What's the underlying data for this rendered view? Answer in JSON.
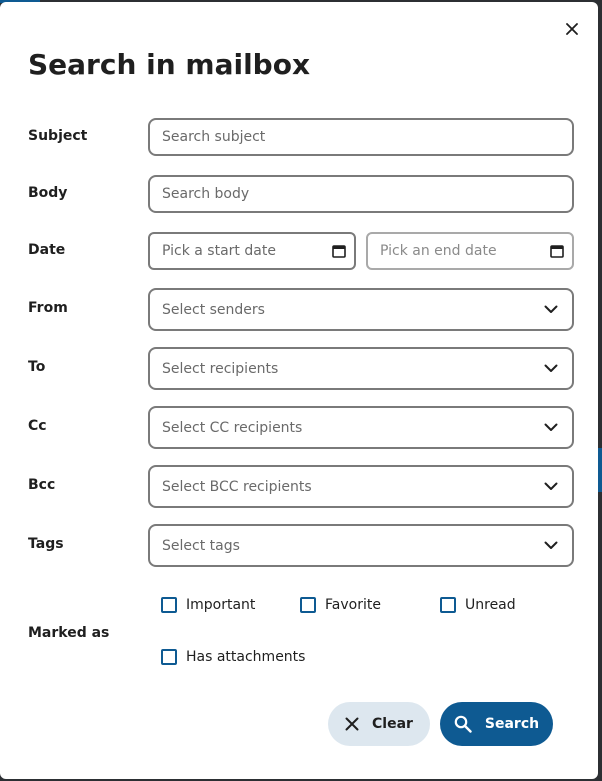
{
  "dialog": {
    "title": "Search in mailbox",
    "close_icon": "close-icon"
  },
  "fields": {
    "subject": {
      "label": "Subject",
      "placeholder": "Search subject"
    },
    "body": {
      "label": "Body",
      "placeholder": "Search body"
    },
    "date": {
      "label": "Date",
      "start_placeholder": "Pick a start date",
      "end_placeholder": "Pick an end date"
    },
    "from": {
      "label": "From",
      "placeholder": "Select senders"
    },
    "to": {
      "label": "To",
      "placeholder": "Select recipients"
    },
    "cc": {
      "label": "Cc",
      "placeholder": "Select CC recipients"
    },
    "bcc": {
      "label": "Bcc",
      "placeholder": "Select BCC recipients"
    },
    "tags": {
      "label": "Tags",
      "placeholder": "Select tags"
    }
  },
  "marked_as": {
    "label": "Marked as",
    "options": [
      {
        "label": "Important",
        "checked": false
      },
      {
        "label": "Favorite",
        "checked": false
      },
      {
        "label": "Unread",
        "checked": false
      },
      {
        "label": "Has attachments",
        "checked": false
      }
    ]
  },
  "actions": {
    "clear_label": "Clear",
    "search_label": "Search"
  },
  "colors": {
    "primary": "#0e5a92",
    "clear_bg": "#dde7ef",
    "border": "#7a7a7a",
    "text": "#1f1f1f"
  }
}
